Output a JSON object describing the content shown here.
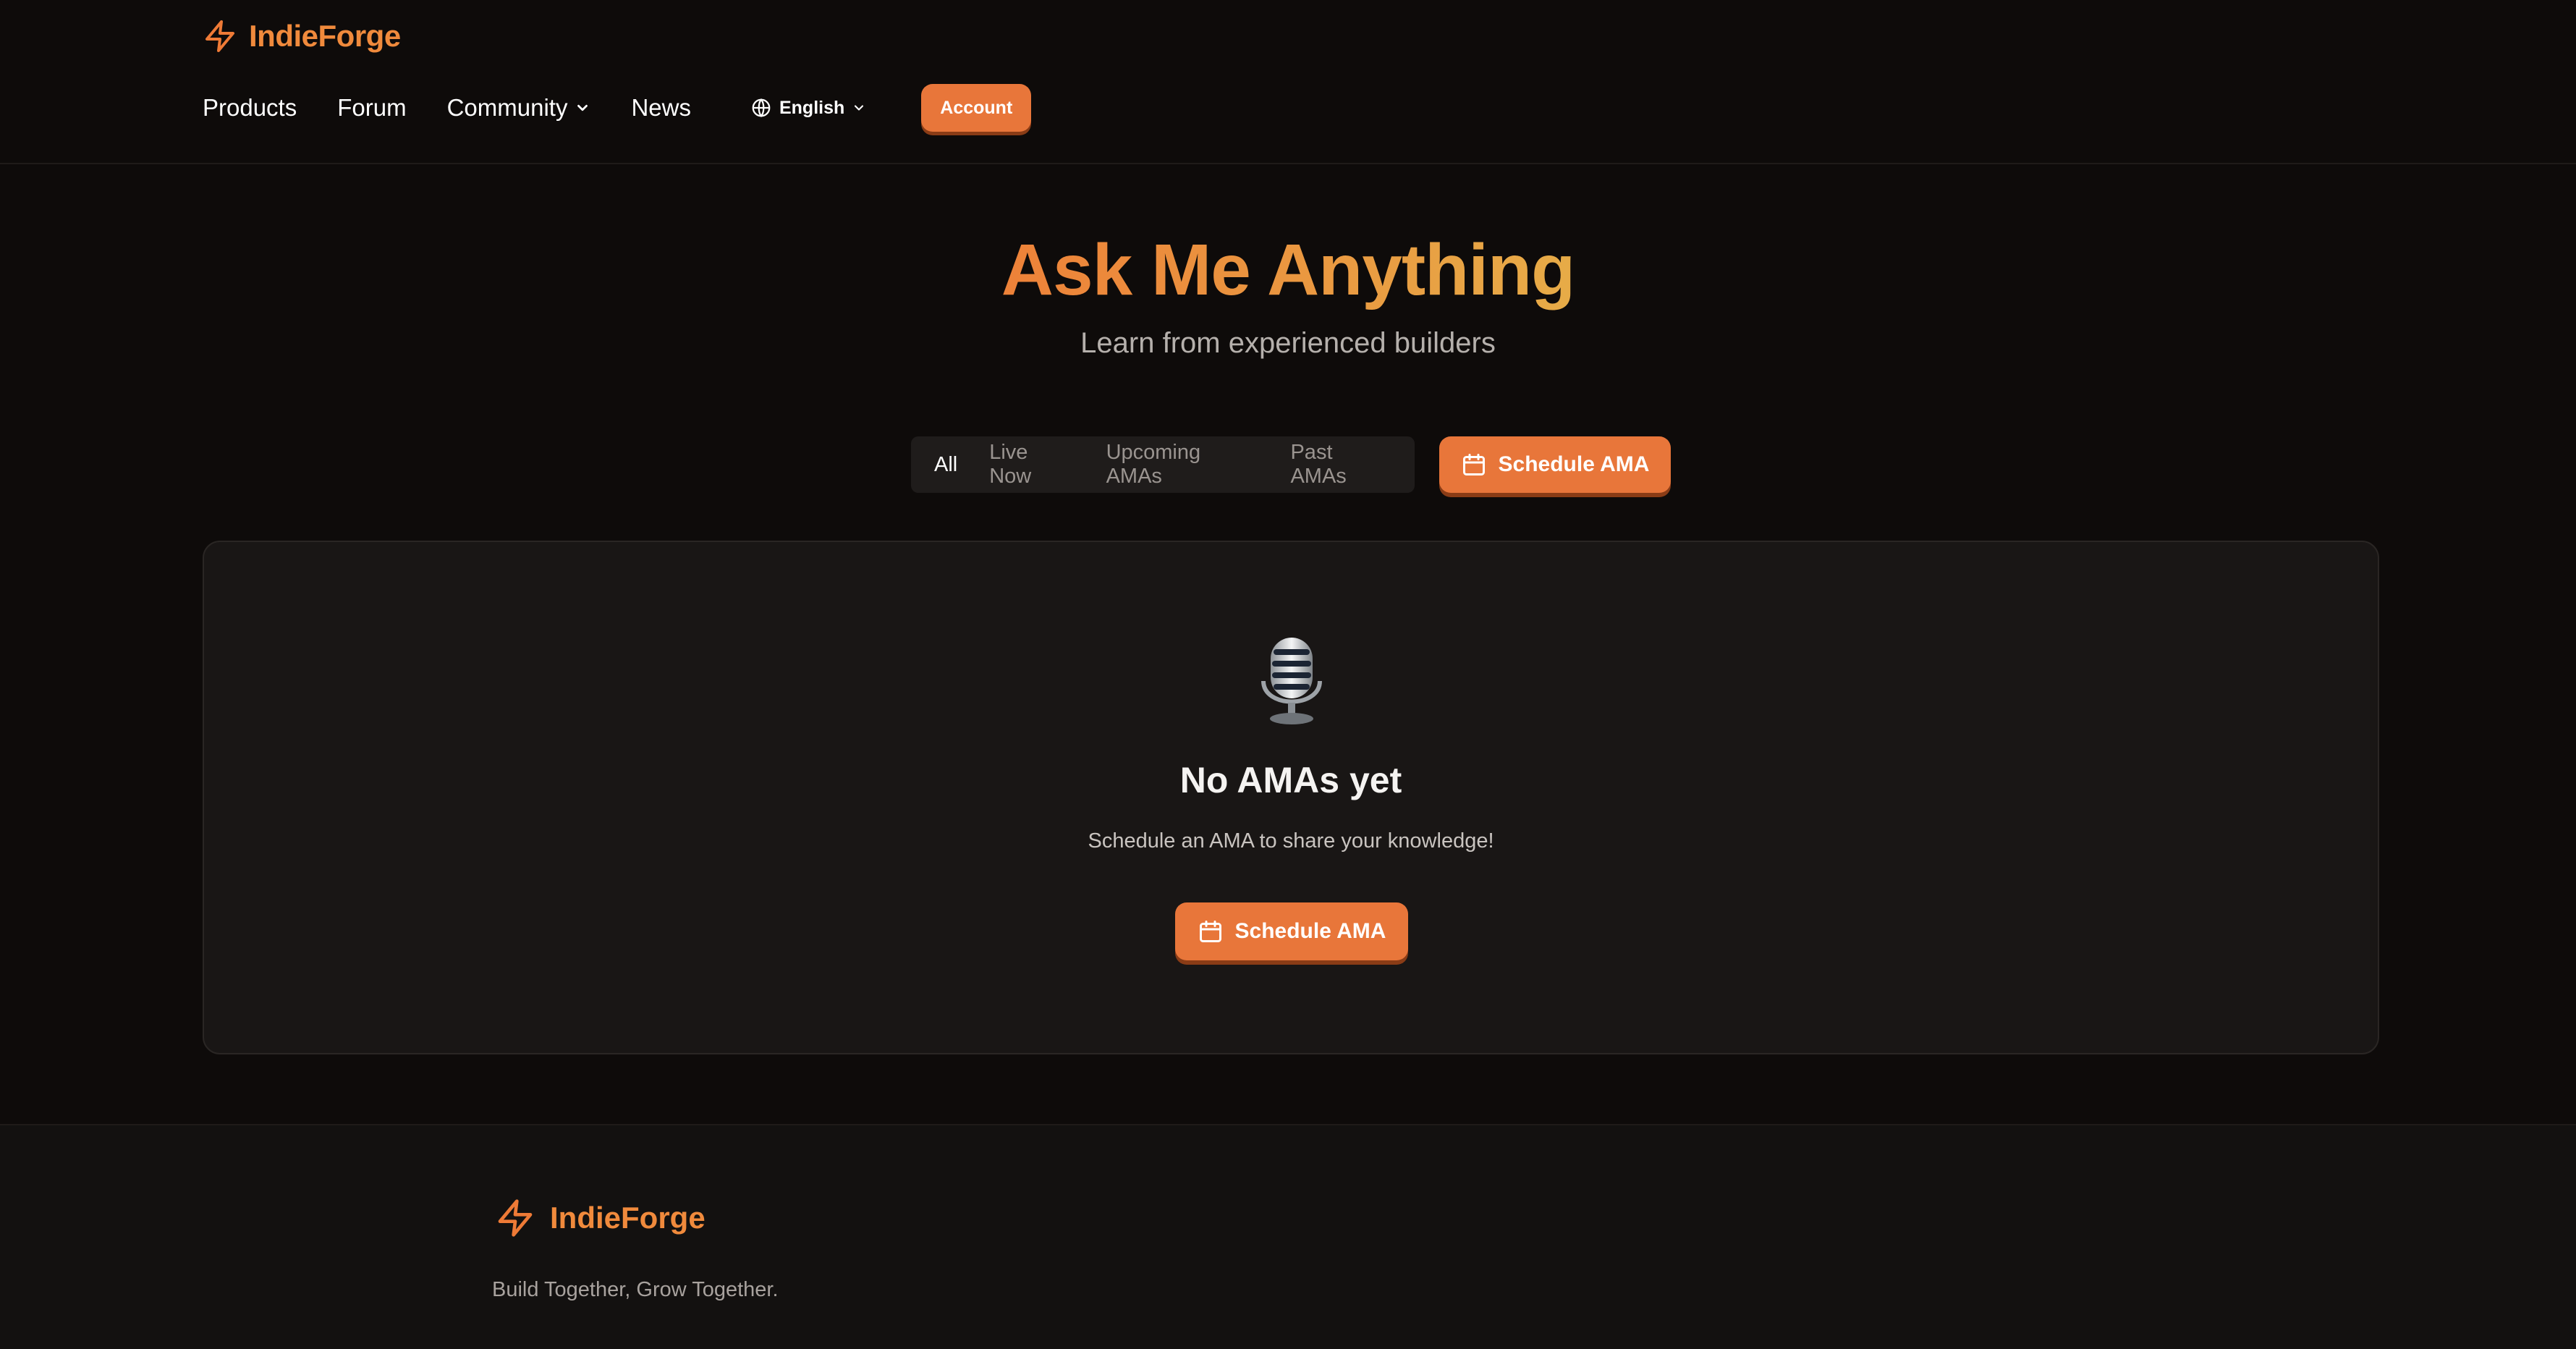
{
  "brand": {
    "name": "IndieForge",
    "icon": "lightning-bolt-icon",
    "color": "#f08a3c"
  },
  "nav": {
    "items": [
      {
        "label": "Products"
      },
      {
        "label": "Forum"
      },
      {
        "label": "Community",
        "has_dropdown": true
      },
      {
        "label": "News"
      }
    ],
    "language": "English",
    "account_label": "Account"
  },
  "hero": {
    "title": "Ask Me Anything",
    "subtitle": "Learn from experienced builders"
  },
  "filters": {
    "tabs": [
      {
        "label": "All",
        "active": true
      },
      {
        "label": "Live Now",
        "active": false
      },
      {
        "label": "Upcoming AMAs",
        "active": false
      },
      {
        "label": "Past AMAs",
        "active": false
      }
    ],
    "schedule_label": "Schedule AMA"
  },
  "empty_state": {
    "icon": "microphone-icon",
    "title": "No AMAs yet",
    "message": "Schedule an AMA to share your knowledge!",
    "button_label": "Schedule AMA"
  },
  "footer": {
    "brand_name": "IndieForge",
    "tagline": "Build Together, Grow Together."
  },
  "colors": {
    "background": "#0e0b0a",
    "card": "#191615",
    "accent": "#e8763a",
    "accent_gradient_end": "#e6b34a"
  }
}
